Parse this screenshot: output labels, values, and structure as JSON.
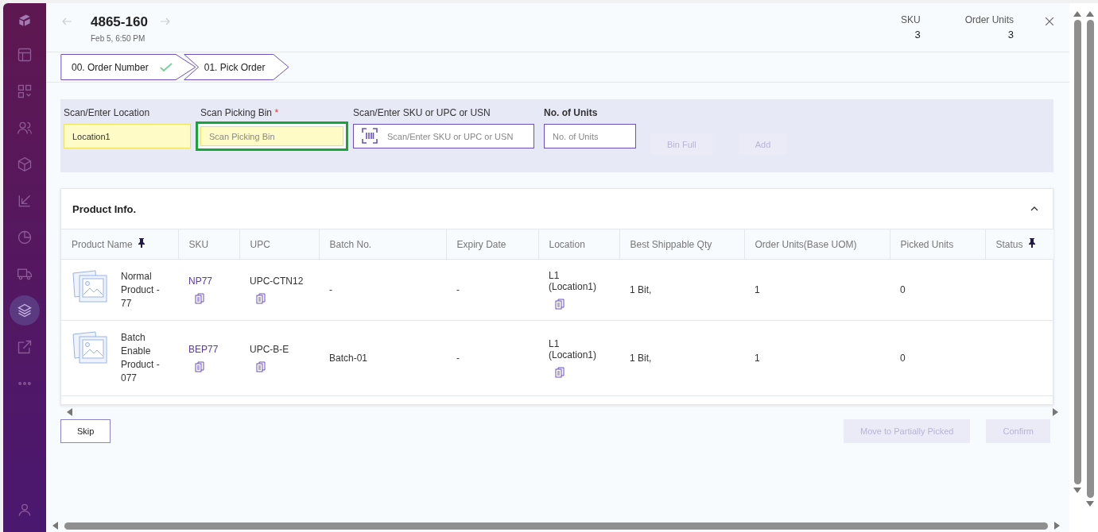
{
  "sidebar": {
    "items": [
      {
        "selected": false
      },
      {
        "selected": false
      },
      {
        "selected": false
      },
      {
        "selected": false
      },
      {
        "selected": false
      },
      {
        "selected": false
      },
      {
        "selected": false
      },
      {
        "selected": true
      },
      {
        "selected": false
      },
      {
        "selected": false
      }
    ]
  },
  "header": {
    "order_number": "4865-160",
    "date": "Feb 5, 6:50 PM",
    "stats": [
      {
        "label": "SKU",
        "value": "3"
      },
      {
        "label": "Order Units",
        "value": "3"
      }
    ]
  },
  "steps": [
    {
      "label": "00. Order Number",
      "completed": true
    },
    {
      "label": "01. Pick Order",
      "completed": false
    }
  ],
  "scan_form": {
    "fields": [
      {
        "label": "Scan/Enter Location",
        "value": "Location1",
        "kind": "filled",
        "focused": false,
        "bold": false
      },
      {
        "label": "Scan Picking Bin",
        "required_mark": "*",
        "placeholder": "Scan Picking Bin",
        "kind": "filled",
        "focused": true,
        "bold": false
      },
      {
        "label": "Scan/Enter SKU or UPC or USN",
        "placeholder": "Scan/Enter SKU or UPC or USN",
        "kind": "barcode",
        "focused": false,
        "bold": false
      },
      {
        "label": "No. of Units",
        "placeholder": "No. of Units",
        "kind": "plain",
        "focused": false,
        "bold": true
      }
    ],
    "buttons": [
      {
        "label": "Bin Full",
        "disabled": true
      },
      {
        "label": "Add",
        "disabled": true
      }
    ]
  },
  "product_info": {
    "title": "Product Info.",
    "expanded": true,
    "columns": [
      {
        "label": "Product Name",
        "pinned": true
      },
      {
        "label": "SKU",
        "pinned": false
      },
      {
        "label": "UPC",
        "pinned": false
      },
      {
        "label": "Batch No.",
        "pinned": false
      },
      {
        "label": "Expiry Date",
        "pinned": false
      },
      {
        "label": "Location",
        "pinned": false
      },
      {
        "label": "Best Shippable Qty",
        "pinned": false
      },
      {
        "label": "Order Units(Base UOM)",
        "pinned": false
      },
      {
        "label": "Picked Units",
        "pinned": false
      },
      {
        "label": "Status",
        "pinned": true
      }
    ],
    "rows": [
      {
        "product_name": "Normal Product - 77",
        "sku": "NP77",
        "upc": "UPC-CTN12",
        "batch_no": "-",
        "expiry_date": "-",
        "location": "L1 (Location1)",
        "best_shippable_qty": "1 Bit,",
        "order_units": "1",
        "picked_units": "0"
      },
      {
        "product_name": "Batch Enable Product - 077",
        "sku": "BEP77",
        "upc": "UPC-B-E",
        "batch_no": "Batch-01",
        "expiry_date": "-",
        "location": "L1 (Location1)",
        "best_shippable_qty": "1 Bit,",
        "order_units": "1",
        "picked_units": "0"
      }
    ]
  },
  "footer": {
    "buttons": [
      {
        "label": "Skip",
        "disabled": false
      },
      {
        "label": "Move to Partially Picked",
        "disabled": true
      },
      {
        "label": "Confirm",
        "disabled": true
      }
    ]
  }
}
